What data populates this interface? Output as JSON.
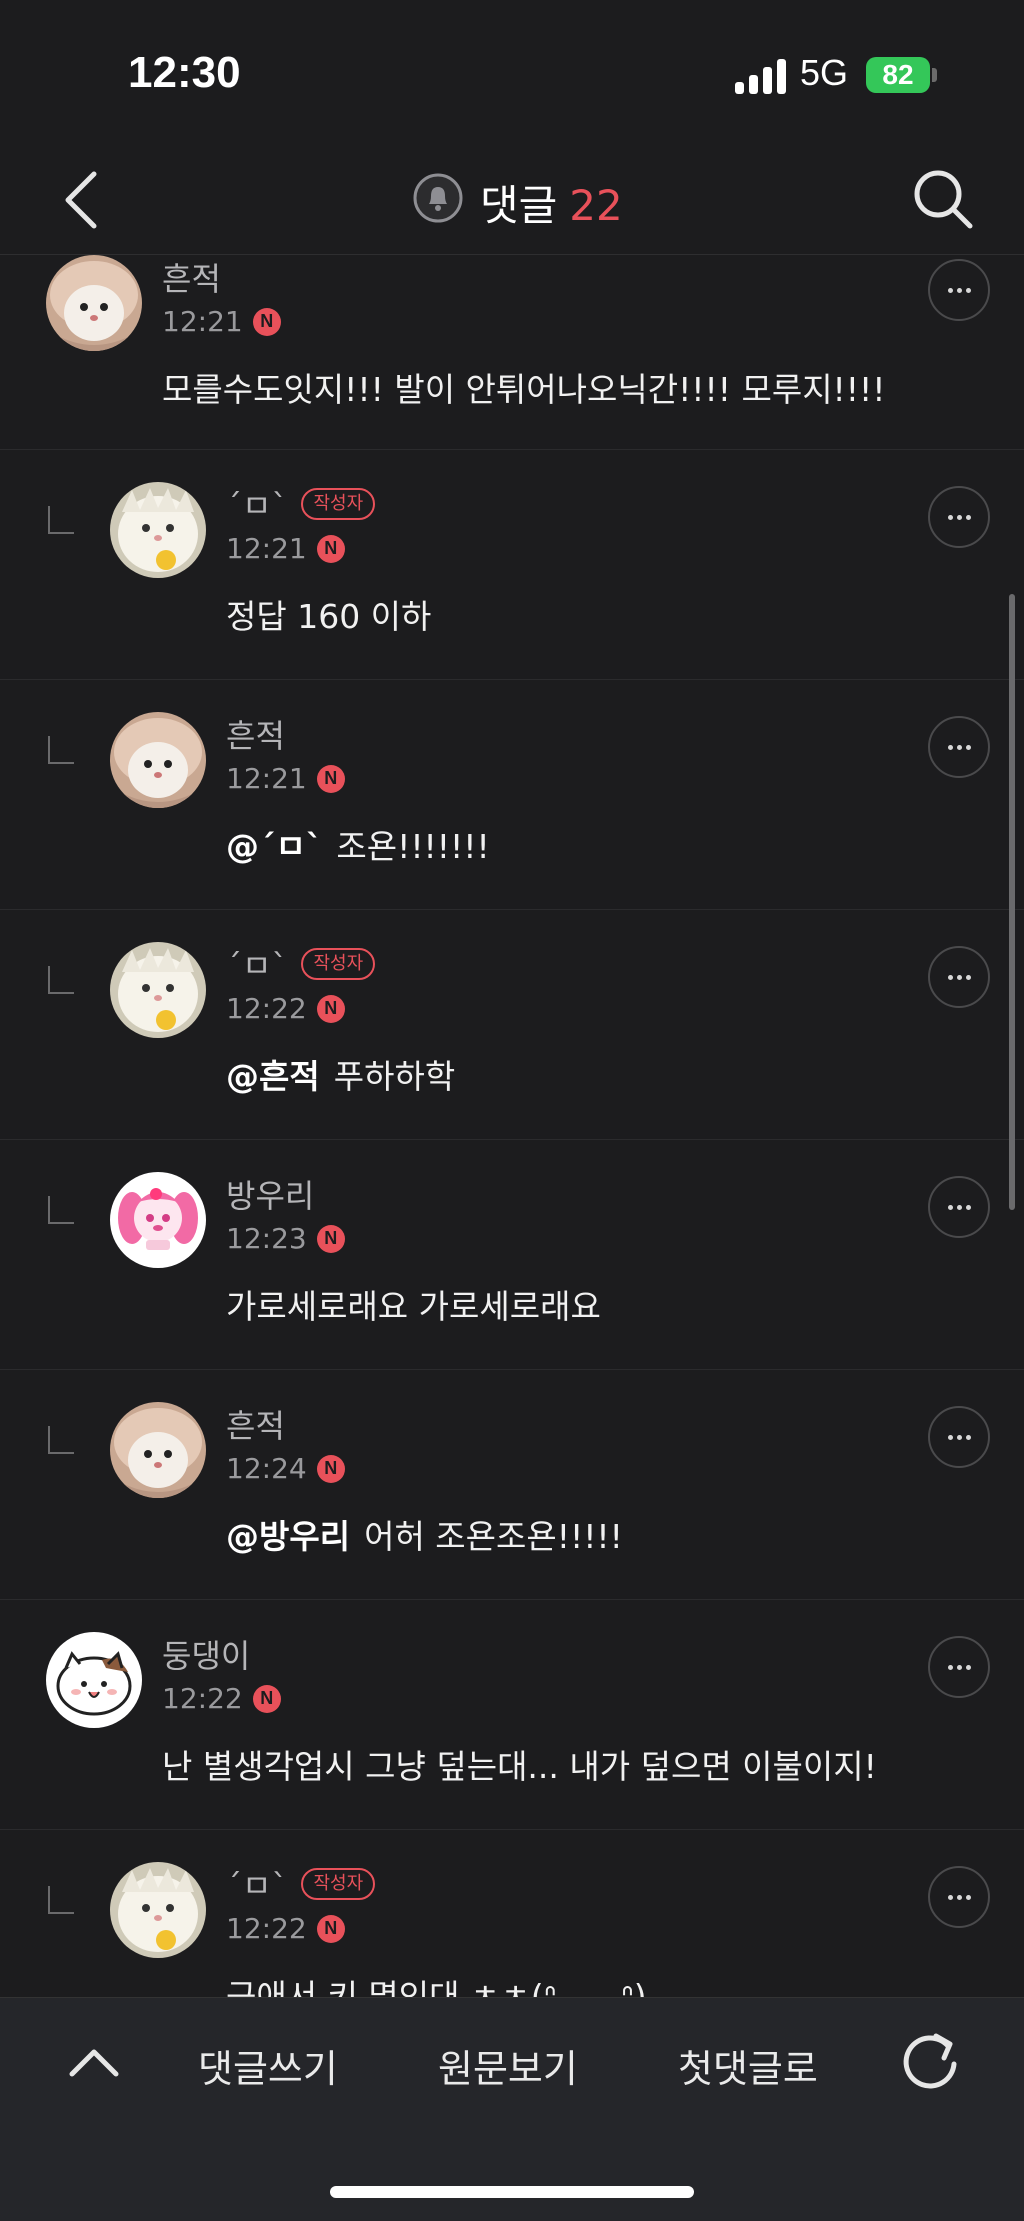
{
  "status_bar": {
    "time": "12:30",
    "network": "5G",
    "battery": "82"
  },
  "header": {
    "title": "댓글",
    "count": "22"
  },
  "comments": [
    {
      "name": "흔적",
      "author": false,
      "time": "12:21",
      "text": "모를수도잇지!!! 발이 안튀어나오닉간!!!! 모루지!!!!",
      "mention": "",
      "is_reply": false,
      "avatar": "hamster-bowl"
    },
    {
      "name": "´ㅁ`",
      "author": true,
      "time": "12:21",
      "text": "정답 160 이하",
      "mention": "",
      "is_reply": true,
      "avatar": "hamster-white"
    },
    {
      "name": "흔적",
      "author": false,
      "time": "12:21",
      "text": "조욘!!!!!!!",
      "mention": "@´ㅁ`",
      "is_reply": true,
      "avatar": "hamster-bowl"
    },
    {
      "name": "´ㅁ`",
      "author": true,
      "time": "12:22",
      "text": "푸하하학",
      "mention": "@흔적",
      "is_reply": true,
      "avatar": "hamster-white"
    },
    {
      "name": "방우리",
      "author": false,
      "time": "12:23",
      "text": "가로세로래요 가로세로래요",
      "mention": "",
      "is_reply": true,
      "avatar": "pink-character"
    },
    {
      "name": "흔적",
      "author": false,
      "time": "12:24",
      "text": "어허 조욘조욘!!!!!",
      "mention": "@방우리",
      "is_reply": true,
      "avatar": "hamster-bowl"
    },
    {
      "name": "둥댕이",
      "author": false,
      "time": "12:22",
      "text": "난 별생각업시 그냥 덮는대... 내가 덮으면 이불이지!",
      "mention": "",
      "is_reply": false,
      "avatar": "white-cat"
    },
    {
      "name": "´ㅁ`",
      "author": true,
      "time": "12:22",
      "text": "근애서 키 몇인대 ㅊㅊ(ᐢ ̥_ ̫ _ᐢ)",
      "mention": "",
      "is_reply": true,
      "avatar": "hamster-white"
    }
  ],
  "labels": {
    "author_badge": "작성자",
    "new_badge": "N"
  },
  "toolbar": {
    "write": "댓글쓰기",
    "original": "원문보기",
    "first": "첫댓글로"
  },
  "colors": {
    "accent": "#e8515a",
    "background": "#1c1c1e",
    "battery": "#34c759"
  },
  "icons": {
    "back": "chevron-left-icon",
    "bell": "bell-icon",
    "search": "search-icon",
    "more": "more-icon",
    "up": "chevron-up-icon",
    "refresh": "refresh-icon"
  }
}
